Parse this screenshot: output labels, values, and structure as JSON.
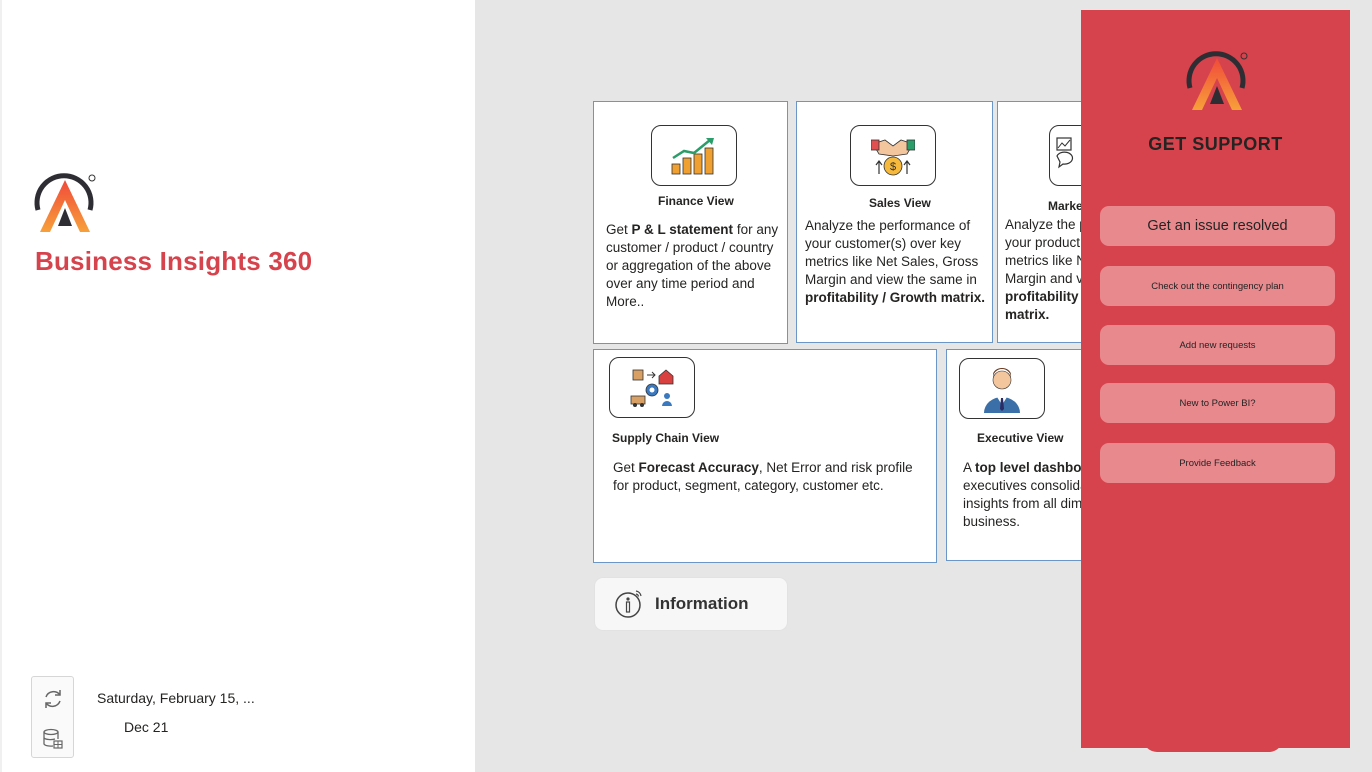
{
  "app": {
    "title": "Business Insights 360"
  },
  "footer": {
    "date": "Saturday, February 15, ...",
    "month": "Dec 21"
  },
  "cards": {
    "finance": {
      "title": "Finance View",
      "desc_pre": "Get ",
      "desc_bold": "P & L statement",
      "desc_post": " for any customer / product / country or aggregation of the above over any time period and More.."
    },
    "sales": {
      "title": "Sales View",
      "desc_pre": "Analyze the performance of your customer(s) over key metrics like Net Sales, Gross Margin and view the same in ",
      "desc_bold": "profitability / Growth matrix."
    },
    "marketing": {
      "title": "Marke",
      "desc_pre": "Analyze the p your product metrics like N Margin and v ",
      "desc_bold": "profitability matrix."
    },
    "supply": {
      "title": "Supply Chain View",
      "desc_pre": "Get ",
      "desc_bold": "Forecast Accuracy",
      "desc_post": ", Net Error and risk profile for product, segment, category, customer etc."
    },
    "executive": {
      "title": "Executive View",
      "desc_pre": "A ",
      "desc_bold": "top level dashbo",
      "desc_post": " executives consolida insights from all dim business."
    }
  },
  "info_button": {
    "label": "Information",
    "icon": "info-icon"
  },
  "support": {
    "title": "GET SUPPORT",
    "buttons": [
      "Get an issue resolved",
      "Check out the contingency plan",
      "Add new requests",
      "New to Power BI?",
      "Provide Feedback"
    ]
  },
  "colors": {
    "brand_red": "#d6434d",
    "button_pink": "#e8898e",
    "card_border": "#6b97c8"
  }
}
